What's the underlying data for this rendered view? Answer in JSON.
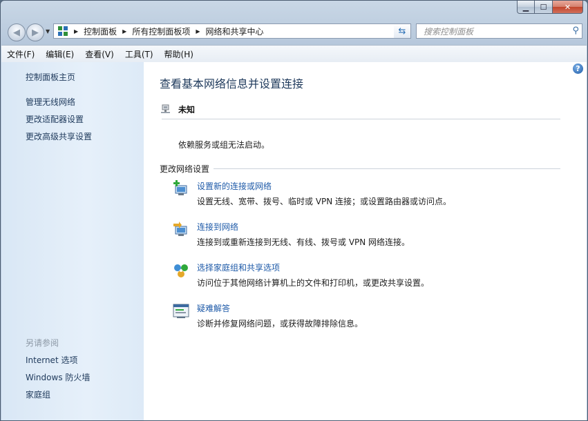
{
  "window": {
    "controls": {
      "minimize": "▁",
      "maximize": "☐",
      "close": "✕"
    }
  },
  "address": {
    "crumbs": [
      "控制面板",
      "所有控制面板项",
      "网络和共享中心"
    ]
  },
  "search": {
    "placeholder": "搜索控制面板"
  },
  "menu": [
    "文件(F)",
    "编辑(E)",
    "查看(V)",
    "工具(T)",
    "帮助(H)"
  ],
  "sidebar": {
    "home": "控制面板主页",
    "links": [
      "管理无线网络",
      "更改适配器设置",
      "更改高级共享设置"
    ],
    "see_also_title": "另请参阅",
    "see_also": [
      "Internet 选项",
      "Windows 防火墙",
      "家庭组"
    ]
  },
  "main": {
    "title": "查看基本网络信息并设置连接",
    "network_name": "未知",
    "dependency_message": "依赖服务或组无法启动。",
    "section_title": "更改网络设置",
    "tasks": [
      {
        "icon": "new-connection-icon",
        "title": "设置新的连接或网络",
        "desc": "设置无线、宽带、拨号、临时或 VPN 连接；或设置路由器或访问点。"
      },
      {
        "icon": "connect-network-icon",
        "title": "连接到网络",
        "desc": "连接到或重新连接到无线、有线、拨号或 VPN 网络连接。"
      },
      {
        "icon": "homegroup-sharing-icon",
        "title": "选择家庭组和共享选项",
        "desc": "访问位于其他网络计算机上的文件和打印机，或更改共享设置。"
      },
      {
        "icon": "troubleshoot-icon",
        "title": "疑难解答",
        "desc": "诊断并修复网络问题，或获得故障排除信息。"
      }
    ]
  },
  "colors": {
    "link": "#1e5aa8",
    "heading": "#1e395b",
    "sidebar_bg": "#dde9f6"
  }
}
